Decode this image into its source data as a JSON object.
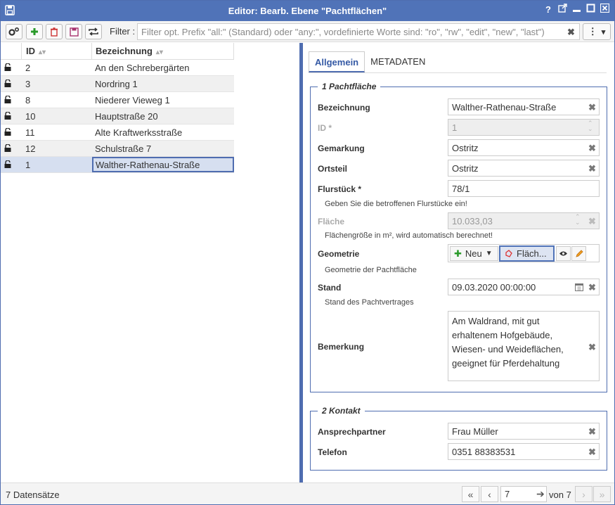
{
  "window": {
    "title": "Editor: Bearb. Ebene \"Pachtflächen\"",
    "buttons": [
      "?",
      "⇱",
      "—",
      "☐",
      "✕"
    ]
  },
  "toolbar": {
    "filter_label": "Filter :",
    "filter_placeholder": "Filter opt. Prefix \"all:\" (Standard) oder \"any:\", vordefinierte Worte sind: \"ro\", \"rw\", \"edit\", \"new\", \"last\")",
    "filter_value": "",
    "clear": "✖",
    "menu_dots": "⋮",
    "menu_caret": "▾"
  },
  "table": {
    "headers": {
      "id": "ID",
      "name": "Bezeichnung"
    },
    "rows": [
      {
        "id": "2",
        "name": "An den Schrebergärten"
      },
      {
        "id": "3",
        "name": "Nordring 1"
      },
      {
        "id": "8",
        "name": "Niederer Vieweg 1"
      },
      {
        "id": "10",
        "name": "Hauptstraße 20"
      },
      {
        "id": "11",
        "name": "Alte Kraftwerksstraße"
      },
      {
        "id": "12",
        "name": "Schulstraße 7"
      },
      {
        "id": "1",
        "name": "Walther-Rathenau-Straße"
      }
    ]
  },
  "tabs": {
    "general": "Allgemein",
    "meta": "METADATEN"
  },
  "section1": {
    "legend": "1 Pachtfläche",
    "bezeichnung_label": "Bezeichnung",
    "bezeichnung_value": "Walther-Rathenau-Straße",
    "id_label": "ID *",
    "id_value": "1",
    "gemarkung_label": "Gemarkung",
    "gemarkung_value": "Ostritz",
    "ortsteil_label": "Ortsteil",
    "ortsteil_value": "Ostritz",
    "flurstueck_label": "Flurstück *",
    "flurstueck_value": "78/1",
    "flurstueck_hint": "Geben Sie die betroffenen Flurstücke ein!",
    "flaeche_label": "Fläche",
    "flaeche_value": "10.033,03",
    "flaeche_hint": "Flächengröße in m², wird automatisch berechnet!",
    "geometrie_label": "Geometrie",
    "geometrie_neu": "Neu",
    "geometrie_flach": "Fläch...",
    "geometrie_hint": "Geometrie der Pachtfläche",
    "stand_label": "Stand",
    "stand_value": "09.03.2020 00:00:00",
    "stand_hint": "Stand des Pachtvertrages",
    "bemerkung_label": "Bemerkung",
    "bemerkung_value": "Am Waldrand, mit gut erhaltenem Hofgebäude, Wiesen- und Weideflächen, geeignet für Pferdehaltung"
  },
  "section2": {
    "legend": "2 Kontakt",
    "ansprechpartner_label": "Ansprechpartner",
    "ansprechpartner_value": "Frau Müller",
    "telefon_label": "Telefon",
    "telefon_value": "0351 88383531"
  },
  "status": {
    "count": "7 Datensätze",
    "page": "7",
    "of": "von 7"
  },
  "icons": {
    "clear": "✖",
    "spin_up": "⌃",
    "spin_down": "⌄",
    "first": "«",
    "prev": "‹",
    "go": "➔",
    "next": "›",
    "last": "»",
    "calendar": "calendar-icon",
    "eye": "eye-icon",
    "pencil": "pencil-icon",
    "plus": "✚"
  },
  "colors": {
    "accent": "#5073b8",
    "add_green": "#2a9a2a",
    "delete_red": "#cc3333"
  }
}
